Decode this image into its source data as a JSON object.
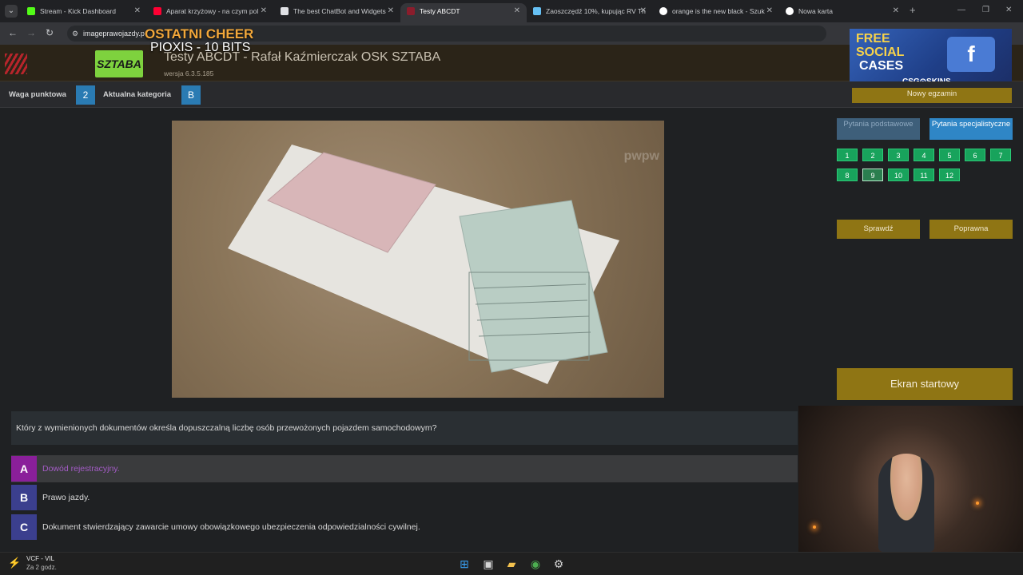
{
  "tabs": [
    {
      "label": "Stream - Kick Dashboard",
      "favicon": "kick-icon",
      "color": "#53fc18"
    },
    {
      "label": "Aparat krzyżowy - na czym pol",
      "favicon": "youtube-icon",
      "color": "#ff0033"
    },
    {
      "label": "The best ChatBot and Widgets",
      "favicon": "bot-icon",
      "color": "#dfe1e5"
    },
    {
      "label": "Testy ABCDT",
      "favicon": "sztaba-icon",
      "color": "#8b1d2c"
    },
    {
      "label": "Zaoszczędź 10%, kupując RV Th",
      "favicon": "steam-icon",
      "color": "#66c0f4"
    },
    {
      "label": "orange is the new black - Szuk",
      "favicon": "google-icon",
      "color": "#ffffff"
    },
    {
      "label": "Nowa karta",
      "favicon": "chrome-icon",
      "color": "#ffffff"
    }
  ],
  "address": {
    "url": "imageprawojazdy.p"
  },
  "overlay": {
    "cheer": "OSTATNI CHEER",
    "bits": "PIOXIS - 10 BITS"
  },
  "header": {
    "title": "Testy ABCDT - Rafał Kaźmierczak OSK SZTABA",
    "version": "wersja 6.3.5.185",
    "logo_text": "SZTABA"
  },
  "ad": {
    "line1": "FREE",
    "line2": "SOCIAL",
    "line3": "CASES",
    "brand": "CSG⊙SKINS"
  },
  "subheader": {
    "weight_label": "Waga punktowa",
    "weight_value": "2",
    "category_label": "Aktualna kategoria",
    "category_value": "B"
  },
  "new_exam_label": "Nowy egzamin",
  "question": {
    "text": "Który z wymienionych dokumentów określa dopuszczalną liczbę osób przewożonych pojazdem samochodowym?",
    "answers": [
      {
        "letter": "A",
        "text": "Dowód rejestracyjny.",
        "color": "#8a1f9a",
        "selected": true
      },
      {
        "letter": "B",
        "text": "Prawo jazdy.",
        "color": "#3b3f8e",
        "selected": false
      },
      {
        "letter": "C",
        "text": "Dokument stwierdzający zawarcie umowy obowiązkowego ubezpieczenia odpowiedzialności cywilnej.",
        "color": "#3b3f8e",
        "selected": false
      }
    ]
  },
  "panel": {
    "mode_basic": "Pytania podstawowe",
    "mode_special": "Pytania specjalistyczne",
    "question_numbers": [
      "1",
      "2",
      "3",
      "4",
      "5",
      "6",
      "7",
      "8",
      "9",
      "10",
      "11",
      "12"
    ],
    "current_question": "9",
    "check_label": "Sprawdź",
    "correct_label": "Poprawna",
    "start_label": "Ekran startowy"
  },
  "taskbar": {
    "weather_line1": "VCF - VIL",
    "weather_line2": "Za 2 godz."
  }
}
